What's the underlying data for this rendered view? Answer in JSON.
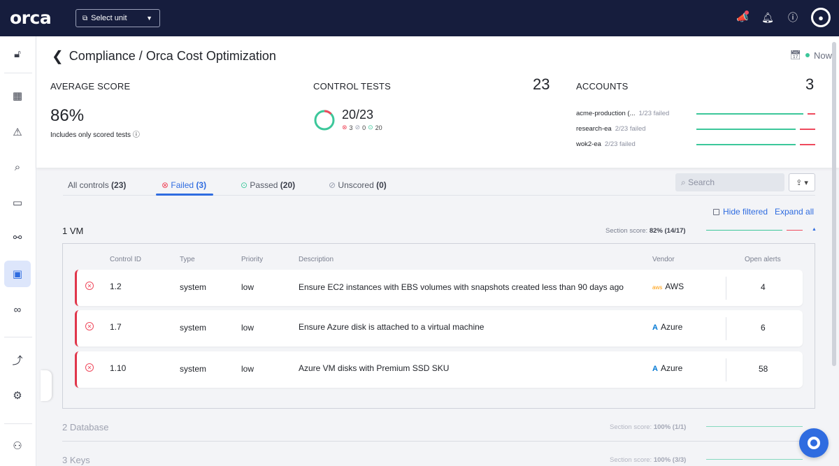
{
  "topbar": {
    "logo": "orca",
    "unit_select": "Select unit",
    "icons": [
      "megaphone-icon",
      "bell-icon",
      "help-icon",
      "user-avatar"
    ]
  },
  "sidebar": {
    "items": [
      "lock-icon",
      "dashboard-icon",
      "alert-icon",
      "search-icon",
      "inventory-icon",
      "graph-icon",
      "compliance-icon",
      "shift-left-icon",
      "integrations-icon",
      "settings-icon",
      "user-settings-icon"
    ],
    "active": "compliance-icon"
  },
  "header": {
    "breadcrumb": "Compliance / Orca Cost Optimization",
    "time": "Now",
    "average_score": {
      "label": "AVERAGE SCORE",
      "value": "86%",
      "note": "Includes only scored tests"
    },
    "control_tests": {
      "label": "CONTROL TESTS",
      "total": "23",
      "fraction": "20/23",
      "failed": "3",
      "unscored": "0",
      "passed": "20"
    },
    "accounts": {
      "label": "ACCOUNTS",
      "total": "3",
      "items": [
        {
          "name": "acme-production (...",
          "failed": "1/23 failed",
          "fail_fraction": 0.043
        },
        {
          "name": "research-ea",
          "failed": "2/23 failed",
          "fail_fraction": 0.087
        },
        {
          "name": "wok2-ea",
          "failed": "2/23 failed",
          "fail_fraction": 0.087
        }
      ]
    }
  },
  "tabs": [
    {
      "label": "All controls",
      "count": "(23)"
    },
    {
      "label": "Failed",
      "count": "(3)"
    },
    {
      "label": "Passed",
      "count": "(20)"
    },
    {
      "label": "Unscored",
      "count": "(0)"
    }
  ],
  "active_tab": "Failed",
  "search": {
    "placeholder": "Search"
  },
  "hide_filtered": "Hide filtered",
  "expand_all": "Expand all",
  "sections": [
    {
      "title": "1 VM",
      "score_label": "Section score:",
      "score": "82% (14/17)",
      "pass_fraction": 0.82
    },
    {
      "title": "2 Database",
      "score_label": "Section score:",
      "score": "100% (1/1)",
      "pass_fraction": 1.0
    },
    {
      "title": "3 Keys",
      "score_label": "Section score:",
      "score": "100% (3/3)",
      "pass_fraction": 1.0
    }
  ],
  "table": {
    "headers": [
      "Control ID",
      "Type",
      "Priority",
      "Description",
      "Vendor",
      "Open alerts"
    ],
    "rows": [
      {
        "id": "1.2",
        "type": "system",
        "priority": "low",
        "description": "Ensure EC2 instances with EBS volumes with snapshots created less than 90 days ago",
        "vendor": "AWS",
        "vendor_icon": "aws-icon",
        "alerts": "4"
      },
      {
        "id": "1.7",
        "type": "system",
        "priority": "low",
        "description": "Ensure Azure disk is attached to a virtual machine",
        "vendor": "Azure",
        "vendor_icon": "azure-icon",
        "alerts": "6"
      },
      {
        "id": "1.10",
        "type": "system",
        "priority": "low",
        "description": "Azure VM disks with Premium SSD SKU",
        "vendor": "Azure",
        "vendor_icon": "azure-icon",
        "alerts": "58"
      }
    ]
  },
  "colors": {
    "accent": "#2f6ce0",
    "fail": "#ef4a5d",
    "pass": "#3cc79a",
    "nav": "#161d3d"
  }
}
